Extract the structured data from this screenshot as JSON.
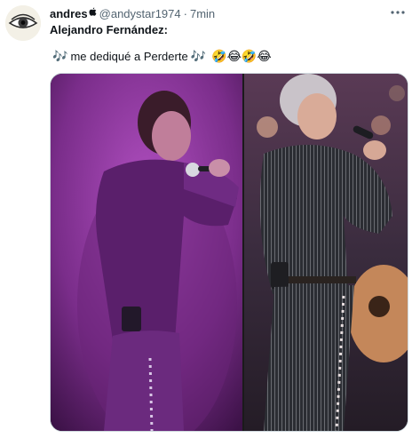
{
  "post": {
    "author_name": "andres",
    "author_badge": "",
    "handle": "@andystar1974",
    "separator": "·",
    "time": "7min",
    "more_label": "···",
    "text_line1": "Alejandro Fernández:",
    "note_icon": "🎶",
    "text_line2": "me dediqué a Perderte",
    "emojis": "🤣😂🤣😂"
  },
  "colors": {
    "name_text": "#0f1419",
    "meta_text": "#536471",
    "accent": "#1d9bf0",
    "left_stage": "#7a2d8a",
    "right_stage": "#3a2c3e"
  },
  "icons": {
    "avatar": "eye-avatar-icon",
    "more": "more-horizontal-icon",
    "notes": "musical-notes-icon"
  }
}
